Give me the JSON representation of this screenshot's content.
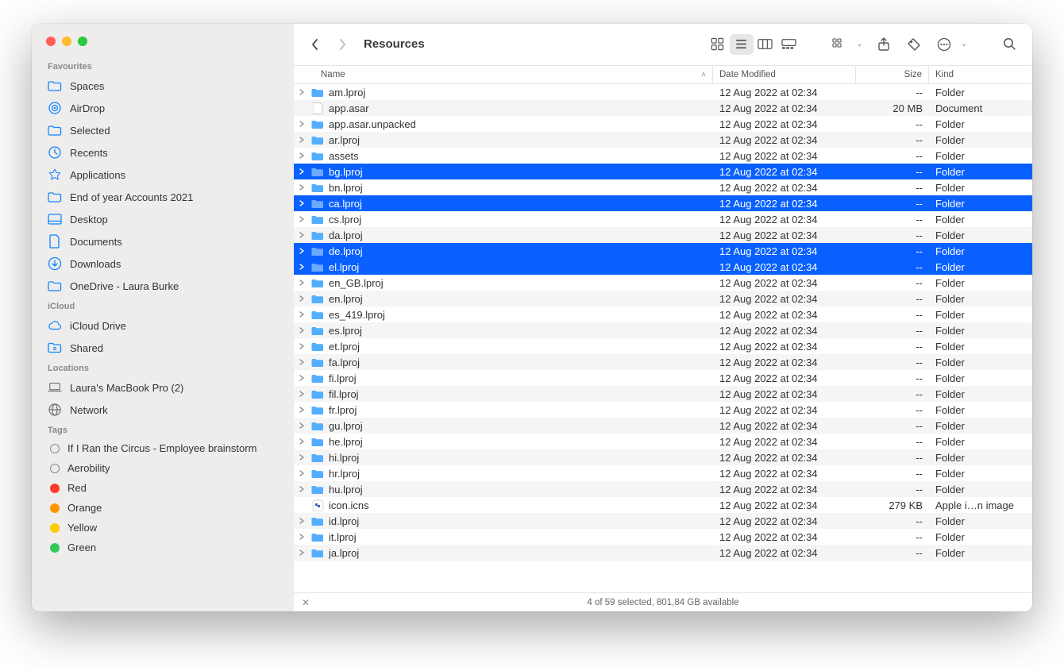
{
  "window_title": "Resources",
  "sidebar": {
    "sections": [
      {
        "title": "Favourites",
        "items": [
          {
            "icon": "folder",
            "label": "Spaces"
          },
          {
            "icon": "airdrop",
            "label": "AirDrop"
          },
          {
            "icon": "folder",
            "label": "Selected"
          },
          {
            "icon": "clock",
            "label": "Recents"
          },
          {
            "icon": "apps",
            "label": "Applications"
          },
          {
            "icon": "folder",
            "label": "End of year Accounts 2021"
          },
          {
            "icon": "desktop",
            "label": "Desktop"
          },
          {
            "icon": "doc",
            "label": "Documents"
          },
          {
            "icon": "download",
            "label": "Downloads"
          },
          {
            "icon": "folder",
            "label": "OneDrive - Laura Burke"
          }
        ]
      },
      {
        "title": "iCloud",
        "items": [
          {
            "icon": "cloud",
            "label": "iCloud Drive"
          },
          {
            "icon": "shared",
            "label": "Shared"
          }
        ]
      },
      {
        "title": "Locations",
        "gray": true,
        "items": [
          {
            "icon": "laptop",
            "label": "Laura's MacBook Pro (2)"
          },
          {
            "icon": "globe",
            "label": "Network"
          }
        ]
      },
      {
        "title": "Tags",
        "items": [
          {
            "tag": "#ffffff00",
            "label": "If I Ran the Circus - Employee brainstorm",
            "outline": true
          },
          {
            "tag": "#ffffff00",
            "label": "Aerobility",
            "outline": true
          },
          {
            "tag": "#ff3b30",
            "label": "Red"
          },
          {
            "tag": "#ff9500",
            "label": "Orange"
          },
          {
            "tag": "#ffcc00",
            "label": "Yellow"
          },
          {
            "tag": "#34c759",
            "label": "Green"
          }
        ]
      }
    ]
  },
  "columns": {
    "name": "Name",
    "date": "Date Modified",
    "size": "Size",
    "kind": "Kind"
  },
  "files": [
    {
      "name": "am.lproj",
      "type": "folder",
      "date": "12 Aug 2022 at 02:34",
      "size": "--",
      "kind": "Folder"
    },
    {
      "name": "app.asar",
      "type": "doc",
      "date": "12 Aug 2022 at 02:34",
      "size": "20 MB",
      "kind": "Document",
      "nodisclosure": true
    },
    {
      "name": "app.asar.unpacked",
      "type": "folder",
      "date": "12 Aug 2022 at 02:34",
      "size": "--",
      "kind": "Folder"
    },
    {
      "name": "ar.lproj",
      "type": "folder",
      "date": "12 Aug 2022 at 02:34",
      "size": "--",
      "kind": "Folder"
    },
    {
      "name": "assets",
      "type": "folder",
      "date": "12 Aug 2022 at 02:34",
      "size": "--",
      "kind": "Folder"
    },
    {
      "name": "bg.lproj",
      "type": "folder",
      "date": "12 Aug 2022 at 02:34",
      "size": "--",
      "kind": "Folder",
      "selected": true
    },
    {
      "name": "bn.lproj",
      "type": "folder",
      "date": "12 Aug 2022 at 02:34",
      "size": "--",
      "kind": "Folder"
    },
    {
      "name": "ca.lproj",
      "type": "folder",
      "date": "12 Aug 2022 at 02:34",
      "size": "--",
      "kind": "Folder",
      "selected": true
    },
    {
      "name": "cs.lproj",
      "type": "folder",
      "date": "12 Aug 2022 at 02:34",
      "size": "--",
      "kind": "Folder"
    },
    {
      "name": "da.lproj",
      "type": "folder",
      "date": "12 Aug 2022 at 02:34",
      "size": "--",
      "kind": "Folder"
    },
    {
      "name": "de.lproj",
      "type": "folder",
      "date": "12 Aug 2022 at 02:34",
      "size": "--",
      "kind": "Folder",
      "selected": true
    },
    {
      "name": "el.lproj",
      "type": "folder",
      "date": "12 Aug 2022 at 02:34",
      "size": "--",
      "kind": "Folder",
      "selected": true
    },
    {
      "name": "en_GB.lproj",
      "type": "folder",
      "date": "12 Aug 2022 at 02:34",
      "size": "--",
      "kind": "Folder"
    },
    {
      "name": "en.lproj",
      "type": "folder",
      "date": "12 Aug 2022 at 02:34",
      "size": "--",
      "kind": "Folder"
    },
    {
      "name": "es_419.lproj",
      "type": "folder",
      "date": "12 Aug 2022 at 02:34",
      "size": "--",
      "kind": "Folder"
    },
    {
      "name": "es.lproj",
      "type": "folder",
      "date": "12 Aug 2022 at 02:34",
      "size": "--",
      "kind": "Folder"
    },
    {
      "name": "et.lproj",
      "type": "folder",
      "date": "12 Aug 2022 at 02:34",
      "size": "--",
      "kind": "Folder"
    },
    {
      "name": "fa.lproj",
      "type": "folder",
      "date": "12 Aug 2022 at 02:34",
      "size": "--",
      "kind": "Folder"
    },
    {
      "name": "fi.lproj",
      "type": "folder",
      "date": "12 Aug 2022 at 02:34",
      "size": "--",
      "kind": "Folder"
    },
    {
      "name": "fil.lproj",
      "type": "folder",
      "date": "12 Aug 2022 at 02:34",
      "size": "--",
      "kind": "Folder"
    },
    {
      "name": "fr.lproj",
      "type": "folder",
      "date": "12 Aug 2022 at 02:34",
      "size": "--",
      "kind": "Folder"
    },
    {
      "name": "gu.lproj",
      "type": "folder",
      "date": "12 Aug 2022 at 02:34",
      "size": "--",
      "kind": "Folder"
    },
    {
      "name": "he.lproj",
      "type": "folder",
      "date": "12 Aug 2022 at 02:34",
      "size": "--",
      "kind": "Folder"
    },
    {
      "name": "hi.lproj",
      "type": "folder",
      "date": "12 Aug 2022 at 02:34",
      "size": "--",
      "kind": "Folder"
    },
    {
      "name": "hr.lproj",
      "type": "folder",
      "date": "12 Aug 2022 at 02:34",
      "size": "--",
      "kind": "Folder"
    },
    {
      "name": "hu.lproj",
      "type": "folder",
      "date": "12 Aug 2022 at 02:34",
      "size": "--",
      "kind": "Folder"
    },
    {
      "name": "icon.icns",
      "type": "icns",
      "date": "12 Aug 2022 at 02:34",
      "size": "279 KB",
      "kind": "Apple i…n image",
      "nodisclosure": true
    },
    {
      "name": "id.lproj",
      "type": "folder",
      "date": "12 Aug 2022 at 02:34",
      "size": "--",
      "kind": "Folder"
    },
    {
      "name": "it.lproj",
      "type": "folder",
      "date": "12 Aug 2022 at 02:34",
      "size": "--",
      "kind": "Folder"
    },
    {
      "name": "ja.lproj",
      "type": "folder",
      "date": "12 Aug 2022 at 02:34",
      "size": "--",
      "kind": "Folder"
    }
  ],
  "status": "4 of 59 selected, 801,84 GB available"
}
